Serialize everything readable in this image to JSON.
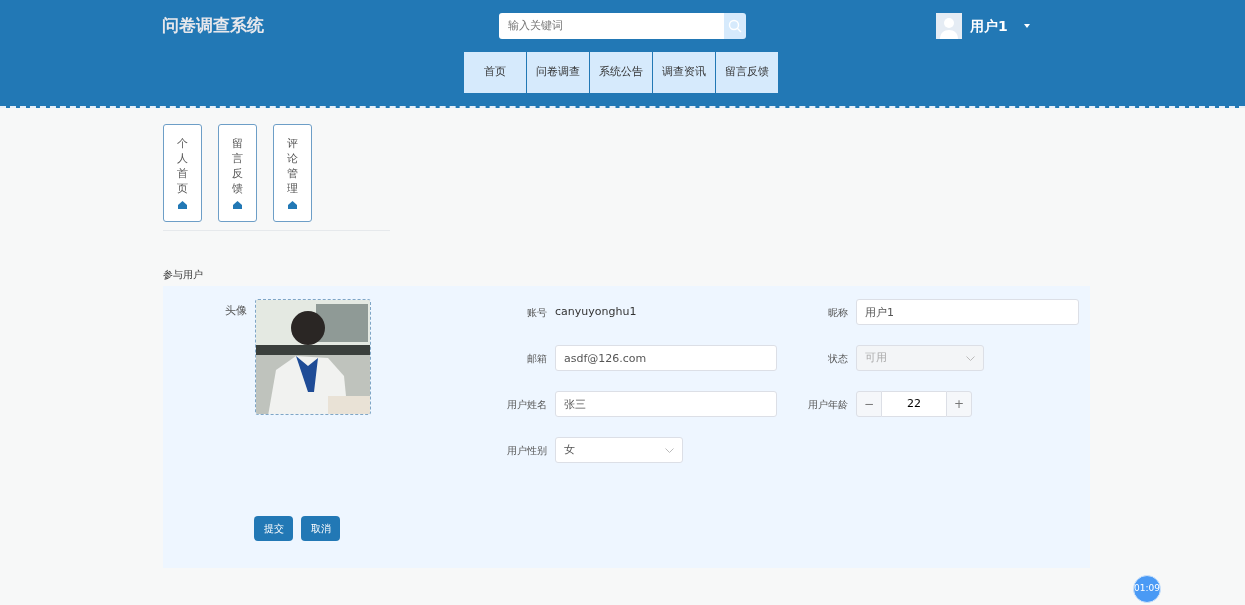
{
  "header": {
    "title": "问卷调查系统",
    "search": {
      "placeholder": "输入关键词"
    },
    "user": {
      "name": "用户1"
    }
  },
  "nav": [
    {
      "label": "首页"
    },
    {
      "label": "问卷调查"
    },
    {
      "label": "系统公告"
    },
    {
      "label": "调查资讯"
    },
    {
      "label": "留言反馈"
    }
  ],
  "side_menu": [
    {
      "label": "个人首页"
    },
    {
      "label": "留言反馈"
    },
    {
      "label": "评论管理"
    }
  ],
  "section_title": "参与用户",
  "form": {
    "avatar": {
      "label": "头像",
      "kind": "picture"
    },
    "rows": [
      [
        {
          "kind": "text",
          "label": "账号",
          "value": "canyuyonghu1"
        },
        {
          "kind": "input",
          "label": "昵称",
          "value": "用户1"
        }
      ],
      [
        {
          "kind": "input",
          "label": "邮箱",
          "value": "asdf@126.com"
        },
        {
          "kind": "select",
          "label": "状态",
          "value": "可用",
          "disabled": true
        }
      ],
      [
        {
          "kind": "input",
          "label": "用户姓名",
          "value": "张三"
        },
        {
          "kind": "stepper",
          "label": "用户年龄",
          "value": "22",
          "minus": "−",
          "plus": "+"
        }
      ],
      [
        {
          "kind": "select",
          "label": "用户性别",
          "value": "女",
          "disabled": false
        }
      ]
    ],
    "buttons": [
      {
        "label": "提交"
      },
      {
        "label": "取消"
      }
    ]
  },
  "timer": "01:09"
}
